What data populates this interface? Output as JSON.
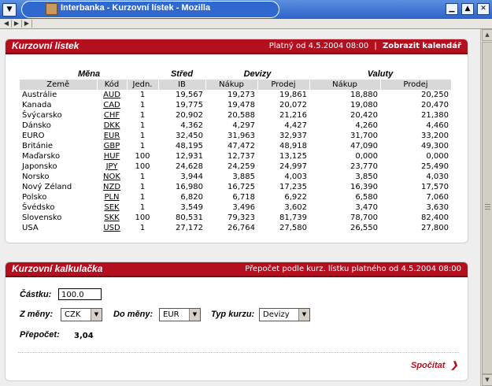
{
  "window": {
    "title": "Interbanka - Kurzovní lístek - Mozilla",
    "menu_glyph": "▼",
    "controls": {
      "minimize": "▁",
      "maximize": "▲",
      "close": "✕"
    }
  },
  "nav": {
    "arrows": [
      "◀",
      "▶",
      "▶"
    ]
  },
  "scrollbar": {
    "up": "▲",
    "down": "▼"
  },
  "rates_panel": {
    "title": "Kurzovní lístek",
    "valid_from": "Platný od 4.5.2004 08:00",
    "separator": "|",
    "calendar_link": "Zobrazit kalendář",
    "group_headers": {
      "mena": "Měna",
      "stred": "Střed",
      "devizy": "Devizy",
      "valuty": "Valuty"
    },
    "column_headers": [
      "Země",
      "Kód",
      "Jedn.",
      "IB",
      "Nákup",
      "Prodej",
      "Nákup",
      "Prodej"
    ],
    "rows": [
      [
        "Austrálie",
        "AUD",
        "1",
        "19,567",
        "19,273",
        "19,861",
        "18,880",
        "20,250"
      ],
      [
        "Kanada",
        "CAD",
        "1",
        "19,775",
        "19,478",
        "20,072",
        "19,080",
        "20,470"
      ],
      [
        "Švýcarsko",
        "CHF",
        "1",
        "20,902",
        "20,588",
        "21,216",
        "20,420",
        "21,380"
      ],
      [
        "Dánsko",
        "DKK",
        "1",
        "4,362",
        "4,297",
        "4,427",
        "4,260",
        "4,460"
      ],
      [
        "EURO",
        "EUR",
        "1",
        "32,450",
        "31,963",
        "32,937",
        "31,700",
        "33,200"
      ],
      [
        "Británie",
        "GBP",
        "1",
        "48,195",
        "47,472",
        "48,918",
        "47,090",
        "49,300"
      ],
      [
        "Maďarsko",
        "HUF",
        "100",
        "12,931",
        "12,737",
        "13,125",
        "0,000",
        "0,000"
      ],
      [
        "Japonsko",
        "JPY",
        "100",
        "24,628",
        "24,259",
        "24,997",
        "23,770",
        "25,490"
      ],
      [
        "Norsko",
        "NOK",
        "1",
        "3,944",
        "3,885",
        "4,003",
        "3,850",
        "4,030"
      ],
      [
        "Nový Zéland",
        "NZD",
        "1",
        "16,980",
        "16,725",
        "17,235",
        "16,390",
        "17,570"
      ],
      [
        "Polsko",
        "PLN",
        "1",
        "6,820",
        "6,718",
        "6,922",
        "6,580",
        "7,060"
      ],
      [
        "Švédsko",
        "SEK",
        "1",
        "3,549",
        "3,496",
        "3,602",
        "3,470",
        "3,630"
      ],
      [
        "Slovensko",
        "SKK",
        "100",
        "80,531",
        "79,323",
        "81,739",
        "78,700",
        "82,400"
      ],
      [
        "USA",
        "USD",
        "1",
        "27,172",
        "26,764",
        "27,580",
        "26,550",
        "27,800"
      ]
    ]
  },
  "calc_panel": {
    "title": "Kurzovní kalkulačka",
    "subtitle": "Přepočet podle kurz. lístku platného od 4.5.2004 08:00",
    "amount_label": "Částku:",
    "amount_value": "100.0",
    "from_label": "Z měny:",
    "from_value": "CZK",
    "to_label": "Do měny:",
    "to_value": "EUR",
    "type_label": "Typ kurzu:",
    "type_value": "Devizy",
    "result_label": "Přepočet:",
    "result_value": "3,04",
    "compute_label": "Spočítat",
    "compute_arrow": "❯",
    "dropdown_arrow": "▼"
  },
  "colors": {
    "accent": "#b40f1f",
    "titlebar": "#2c63c9"
  }
}
